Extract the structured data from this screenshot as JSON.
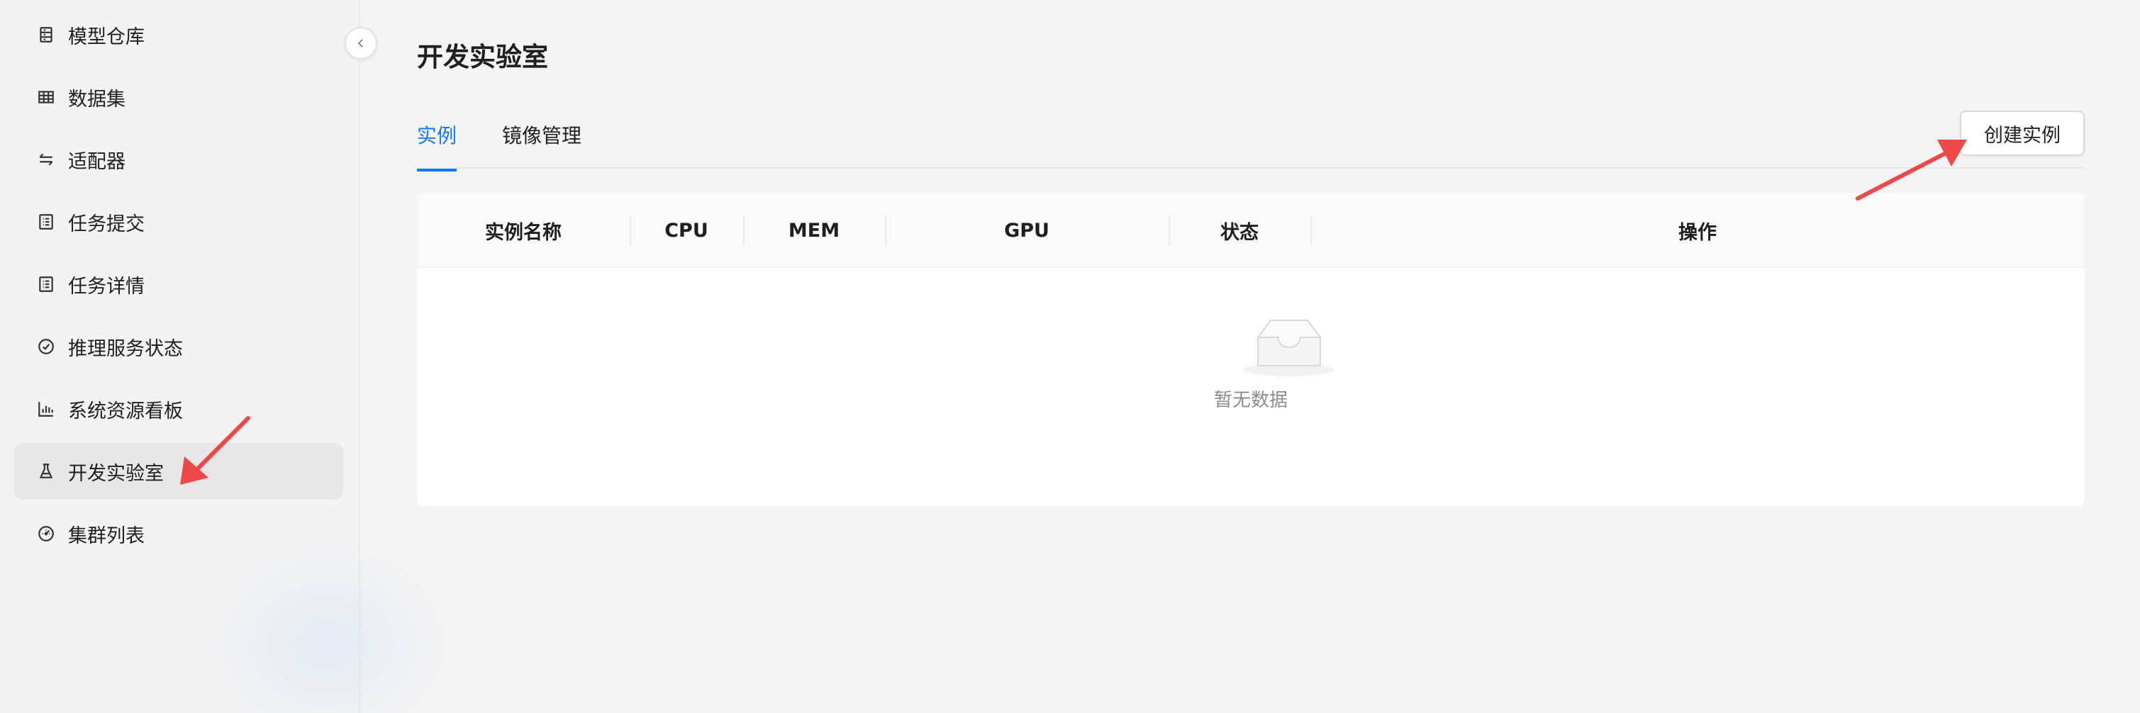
{
  "sidebar": {
    "items": [
      {
        "label": "模型仓库",
        "icon": "model-repo-icon"
      },
      {
        "label": "数据集",
        "icon": "table-grid-icon"
      },
      {
        "label": "适配器",
        "icon": "swap-arrows-icon"
      },
      {
        "label": "任务提交",
        "icon": "list-doc-icon"
      },
      {
        "label": "任务详情",
        "icon": "list-doc-icon"
      },
      {
        "label": "推理服务状态",
        "icon": "check-circle-icon"
      },
      {
        "label": "系统资源看板",
        "icon": "bar-chart-icon"
      },
      {
        "label": "开发实验室",
        "icon": "flask-icon",
        "active": true
      },
      {
        "label": "集群列表",
        "icon": "dashboard-gauge-icon"
      }
    ]
  },
  "main": {
    "title": "开发实验室",
    "tabs": [
      {
        "label": "实例",
        "active": true
      },
      {
        "label": "镜像管理",
        "active": false
      }
    ],
    "create_button": "创建实例",
    "table": {
      "columns": [
        "实例名称",
        "CPU",
        "MEM",
        "GPU",
        "状态",
        "操作"
      ],
      "rows": [],
      "empty_text": "暂无数据"
    }
  },
  "colors": {
    "accent": "#1677ff",
    "annotation_arrow": "#f04848"
  }
}
